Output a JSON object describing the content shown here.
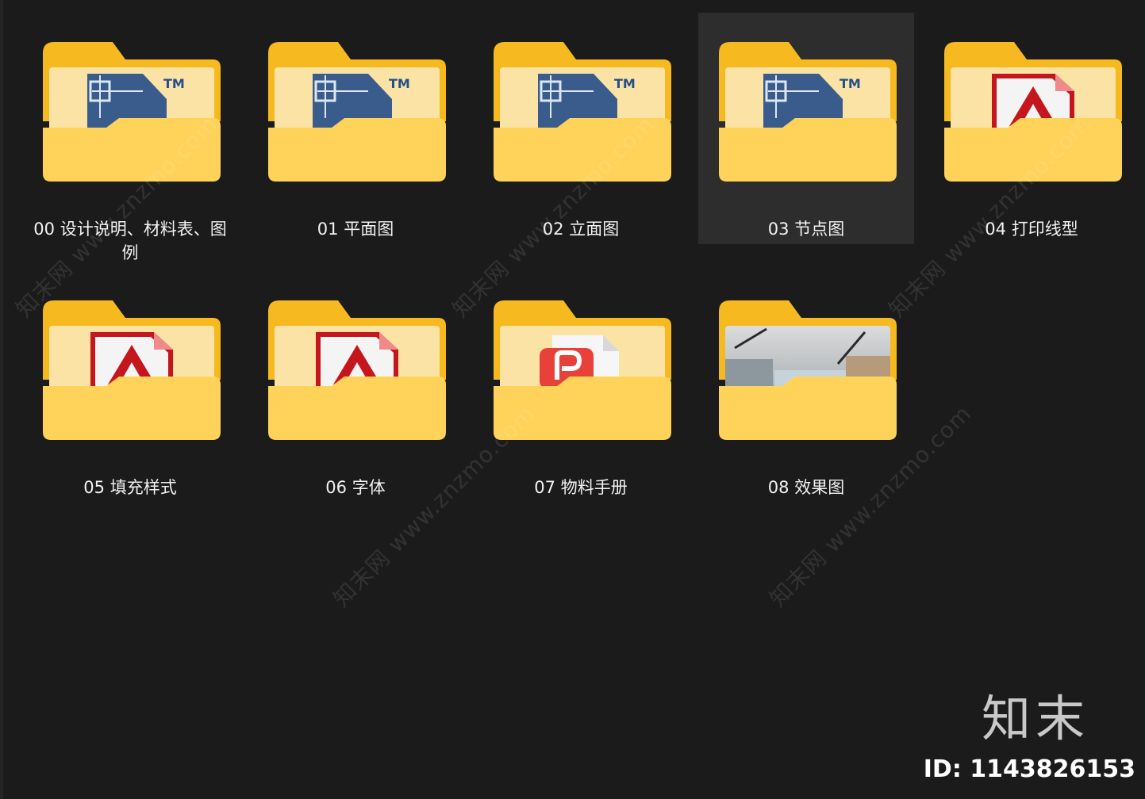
{
  "folders": [
    {
      "label": "00 设计说明、材料表、图例",
      "icon": "autocad-icon"
    },
    {
      "label": "01 平面图",
      "icon": "autocad-icon"
    },
    {
      "label": "02 立面图",
      "icon": "autocad-icon"
    },
    {
      "label": "03 节点图",
      "icon": "autocad-icon"
    },
    {
      "label": "04 打印线型",
      "icon": "autodesk-icon"
    },
    {
      "label": "05 填充样式",
      "icon": "autodesk-icon"
    },
    {
      "label": "06 字体",
      "icon": "autodesk-icon"
    },
    {
      "label": "07 物料手册",
      "icon": "wps-pdf-icon"
    },
    {
      "label": "08 效果图",
      "icon": "image-thumbnail"
    }
  ],
  "selected_index": 3,
  "watermark": {
    "text": "知末网 www.znzmo.com"
  },
  "brand": {
    "name": "知末",
    "id_label": "ID: 1143826153"
  },
  "colors": {
    "background": "#1b1b1b",
    "folder_back": "#f6b91f",
    "folder_front": "#ffd35a",
    "selection": "#2d2d2d"
  }
}
